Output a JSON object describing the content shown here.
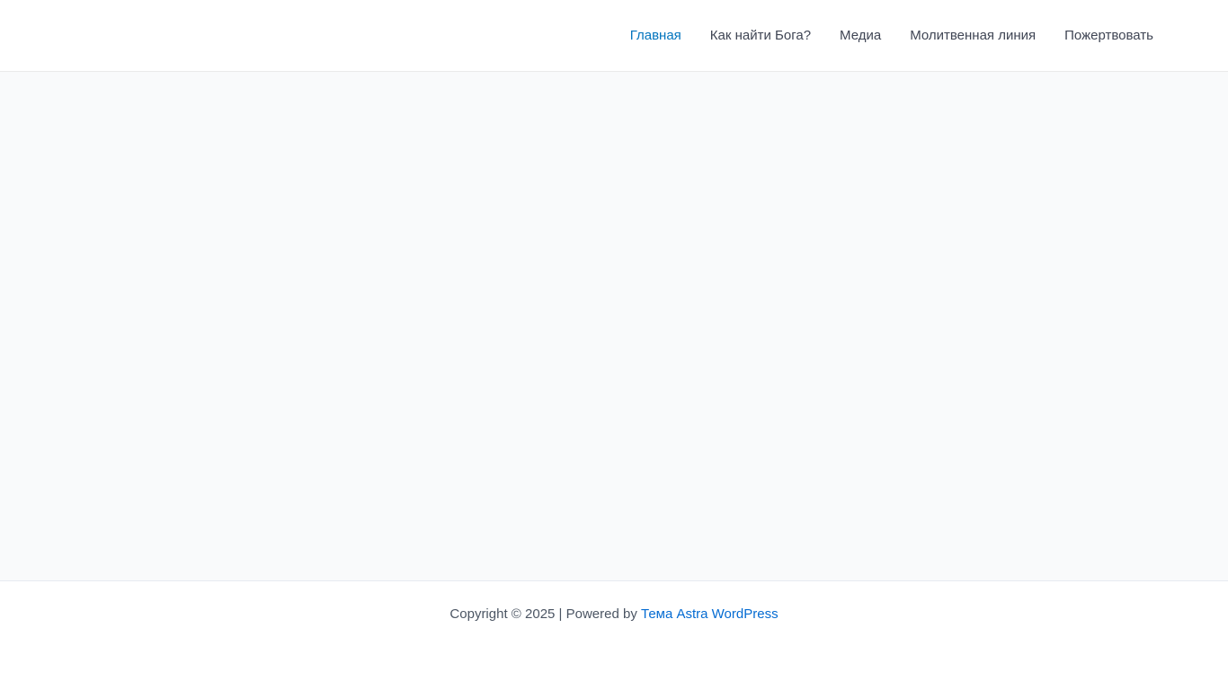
{
  "header": {
    "nav_items": [
      {
        "id": "glavnaya",
        "label": "Главная",
        "active": true
      },
      {
        "id": "kak-nayti-boga",
        "label": "Как найти Бога?",
        "active": false
      },
      {
        "id": "media",
        "label": "Медиа",
        "active": false
      },
      {
        "id": "molitvennaya-liniya",
        "label": "Молитвенная линия",
        "active": false
      },
      {
        "id": "pozhertvovat",
        "label": "Пожертвовать",
        "active": false
      }
    ]
  },
  "main": {
    "content": ""
  },
  "footer": {
    "copyright_text": "Copyright © 2025 | Powered by",
    "theme_link_label": "Тема Astra WordPress"
  },
  "colors": {
    "nav_active": "#0274be",
    "nav_default": "#3f4554",
    "footer_link": "#046bd2",
    "footer_text": "#4b5563",
    "content_background": "#f9fafb"
  }
}
